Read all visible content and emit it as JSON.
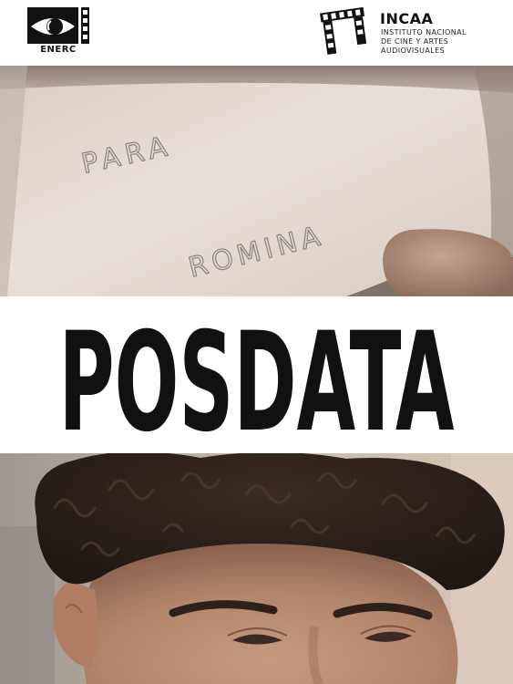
{
  "film": {
    "title": "POSDATA"
  },
  "logos": {
    "left": {
      "name": "ENERC",
      "icon": "film-eye-icon"
    },
    "right": {
      "name": "INCAA",
      "subtitle_lines": [
        "INSTITUTO NACIONAL",
        "DE CINE Y ARTES",
        "AUDIOVISUALES"
      ],
      "icon": "film-strip-icon"
    }
  },
  "stills": {
    "envelope": {
      "handwriting": [
        "PARA",
        "ROMINA"
      ]
    }
  },
  "colors": {
    "background": "#ffffff",
    "title": "#111111",
    "envelope_paper": "#e6dcd4",
    "skin": "#b88a70",
    "hair": "#2a2019"
  }
}
